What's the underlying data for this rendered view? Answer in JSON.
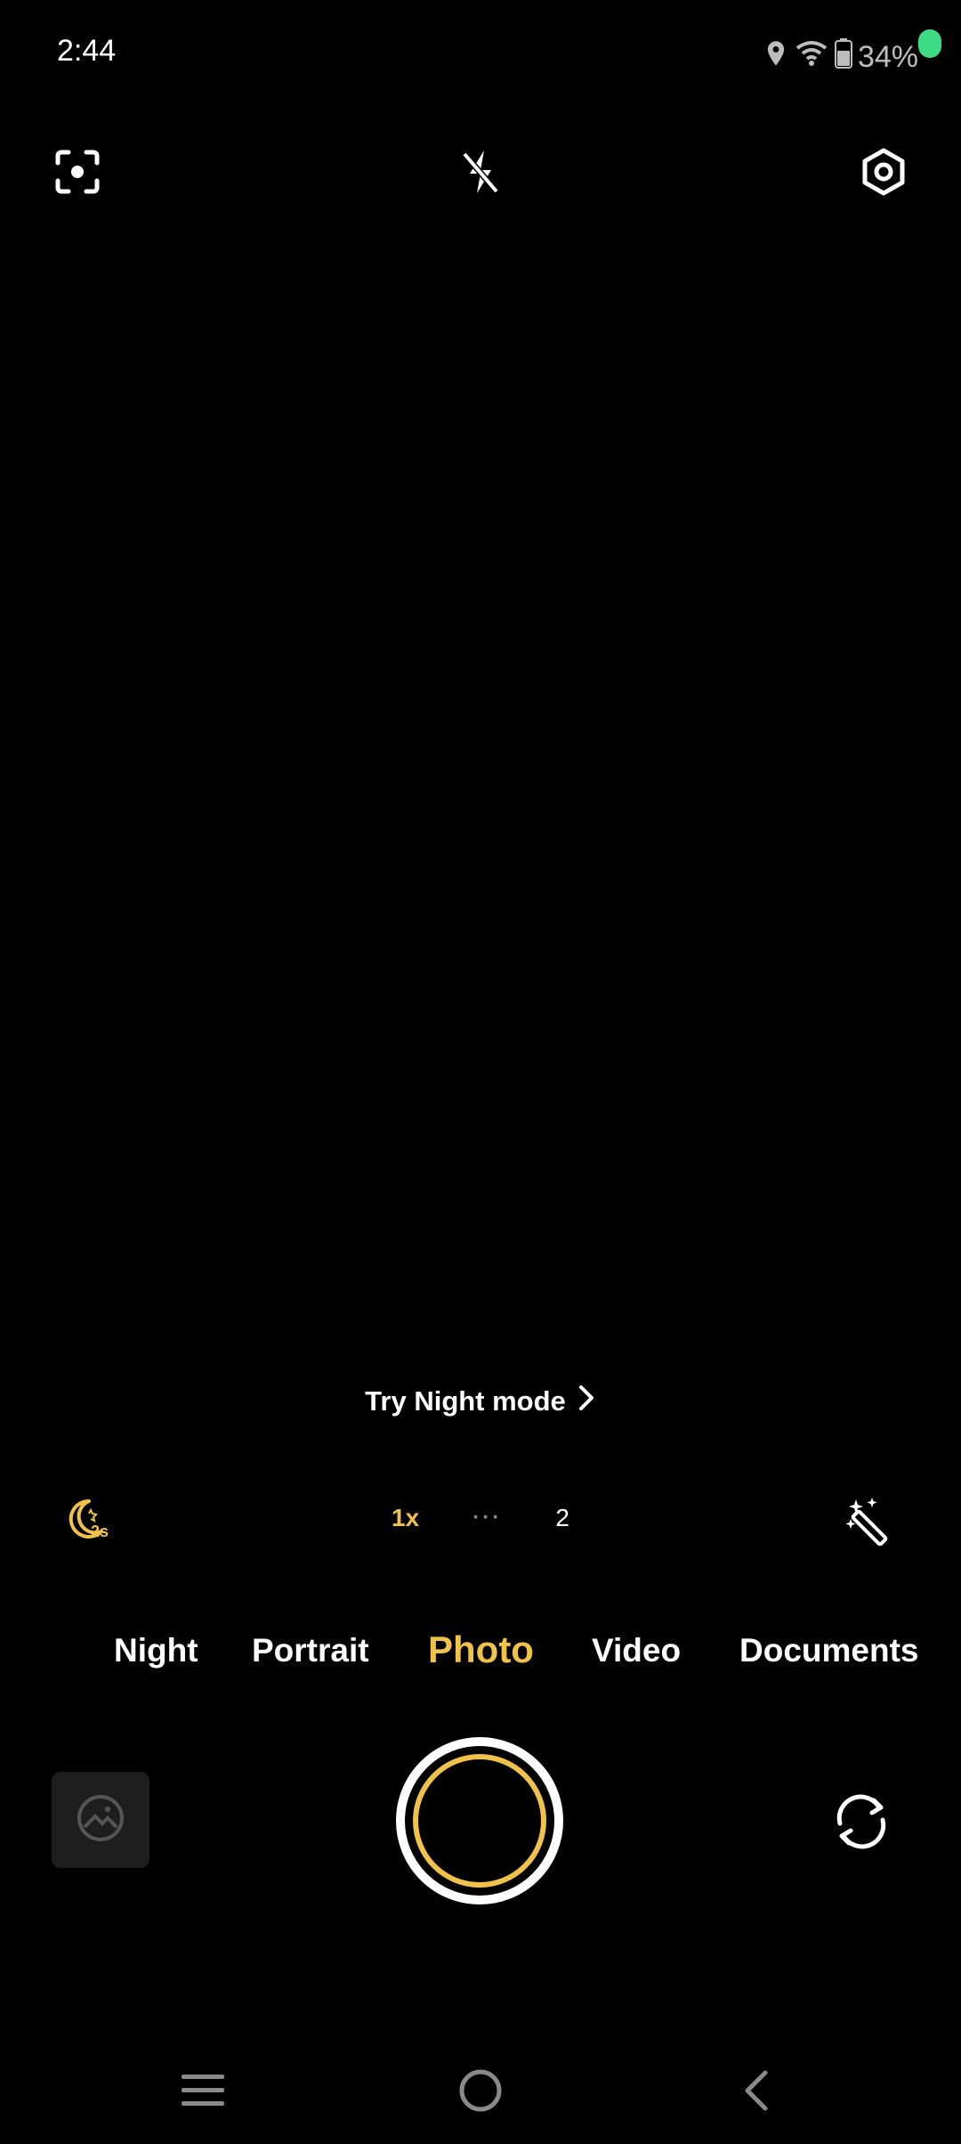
{
  "status_bar": {
    "time": "2:44",
    "battery_percent": "34%",
    "icons": [
      "location-icon",
      "wifi-icon",
      "battery-icon"
    ]
  },
  "top_controls": {
    "icons": [
      "scan-icon",
      "flash-off-icon",
      "settings-icon"
    ]
  },
  "night_hint": {
    "label": "Try Night mode",
    "icon": "chevron-right-icon"
  },
  "zoom": {
    "active": "1x",
    "dots": "···",
    "other": "2"
  },
  "side_controls": {
    "left_icon": "night-timer-icon",
    "left_badge": "2s",
    "right_icon": "magic-wand-icon"
  },
  "modes": [
    {
      "label": "Night",
      "active": false
    },
    {
      "label": "Portrait",
      "active": false
    },
    {
      "label": "Photo",
      "active": true
    },
    {
      "label": "Video",
      "active": false
    },
    {
      "label": "Documents",
      "active": false
    }
  ],
  "colors": {
    "accent": "#f0c24a",
    "background": "#000000",
    "privacy_dot": "#3ddc84"
  },
  "nav_bar": {
    "icons": [
      "menu-icon",
      "home-icon",
      "back-icon"
    ]
  }
}
